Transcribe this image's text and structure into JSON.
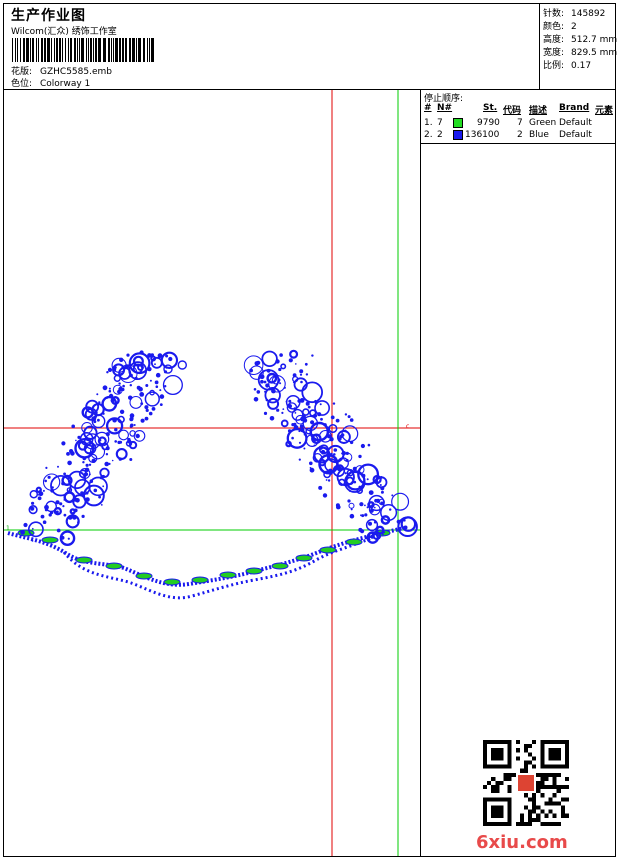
{
  "header": {
    "title": "生产作业图",
    "subtitle": "Wilcom(汇众) 绣饰工作室",
    "design_label": "花版:",
    "design_value": "GZHC5585.emb",
    "colorway_label": "色位:",
    "colorway_value": "Colorway 1"
  },
  "stats": [
    {
      "label": "针数:",
      "value": "145892"
    },
    {
      "label": "颜色:",
      "value": "2"
    },
    {
      "label": "高度:",
      "value": "512.7 mm"
    },
    {
      "label": "宽度:",
      "value": "829.5 mm"
    },
    {
      "label": "比例:",
      "value": "0.17"
    }
  ],
  "stop_panel": {
    "title": "停止顺序:",
    "columns": [
      "#",
      "N#",
      "St.",
      "代码",
      "描述",
      "Brand",
      "元素"
    ],
    "rows": [
      {
        "num": "1.",
        "n": "7",
        "color": "#22dd22",
        "stitches": "9790",
        "code": "7",
        "desc": "Green",
        "brand": "Default"
      },
      {
        "num": "2.",
        "n": "2",
        "color": "#1a1aee",
        "stitches": "136100",
        "code": "2",
        "desc": "Blue",
        "brand": "Default"
      }
    ]
  },
  "canvas": {
    "marker_left": "1",
    "marker_right": "c",
    "stitch_blue": "#1a1aee",
    "stitch_green": "#22cc22",
    "guide_red": "#e00000",
    "guide_green": "#00cc00"
  },
  "watermark": "6xiu.com"
}
